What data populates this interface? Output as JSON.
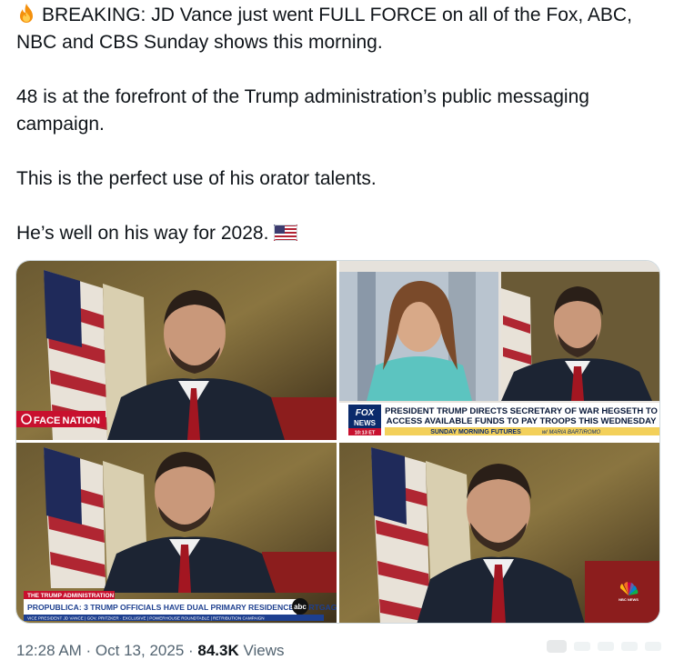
{
  "tweet": {
    "line1": "BREAKING: JD Vance just went FULL FORCE on all of the Fox, ABC, NBC and CBS Sunday shows this morning.",
    "line2": "48 is at the forefront of the Trump administration’s public messaging campaign.",
    "line3": "This is the perfect use of his orator talents.",
    "line4": "He’s well on his way for 2028.",
    "leading_emoji": "fire-icon",
    "trailing_emoji": "us-flag-icon"
  },
  "media": {
    "cbs": {
      "logo_text": "FACE NATION"
    },
    "fox": {
      "network": "FOX",
      "network2": "NEWS",
      "time": "10:13 ET",
      "headline_line1": "PRESIDENT TRUMP DIRECTS SECRETARY OF WAR HEGSETH TO",
      "headline_line2": "ACCESS AVAILABLE FUNDS TO PAY TROOPS THIS WEDNESDAY",
      "show": "SUNDAY MORNING FUTURES",
      "host": "w/ MARIA BARTIROMO"
    },
    "abc": {
      "tag": "THE TRUMP ADMINISTRATION",
      "headline": "PROPUBLICA: 3 TRUMP OFFICIALS HAVE DUAL PRIMARY RESIDENCE MORTGAGES",
      "logo": "abc",
      "ticker": "VICE PRESIDENT JD VANCE  |  GOV. PRITZKER · EXCLUSIVE  |  POWERHOUSE ROUNDTABLE  |  RETRIBUTION CAMPAIGN"
    },
    "nbc": {
      "logo": "NBC NEWS"
    }
  },
  "meta": {
    "time": "12:28 AM · Oct 13, 2025 · ",
    "views_count": "84.3K",
    "views_label": " Views"
  },
  "colors": {
    "text": "#0f1419",
    "secondary": "#536471",
    "border": "#cfd9de",
    "cbs_red": "#c8102e",
    "fox_blue": "#0a2a6b",
    "abc_blue": "#1d3f8f"
  }
}
